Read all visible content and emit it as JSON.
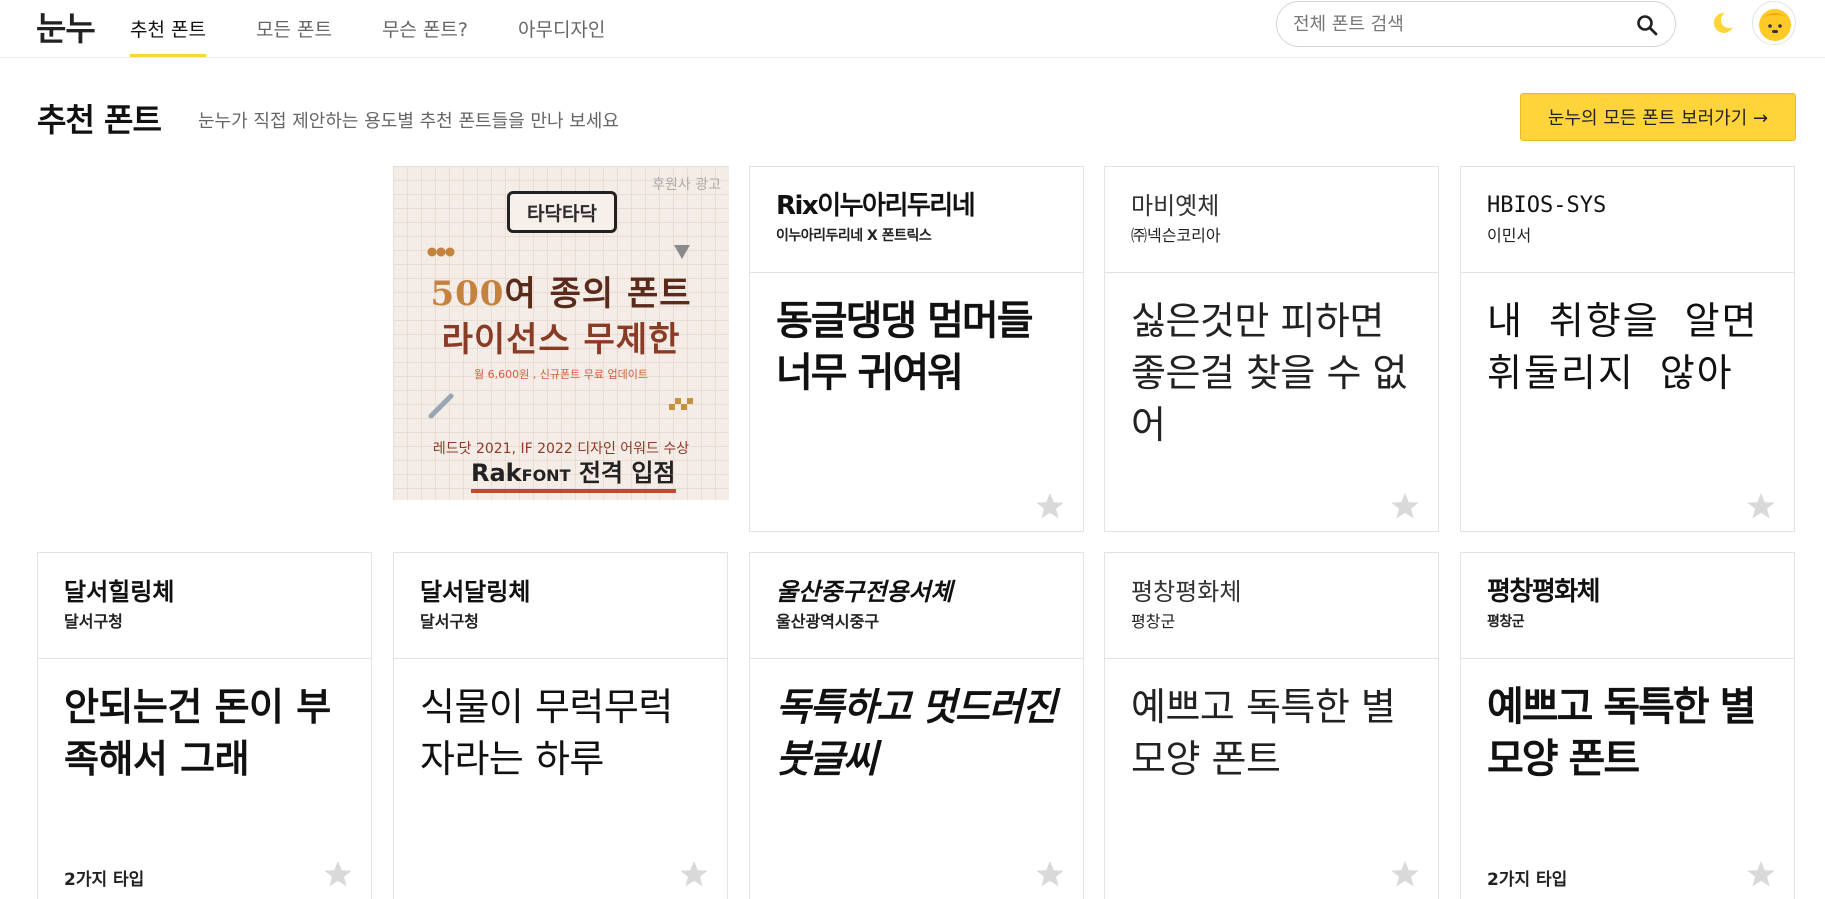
{
  "header": {
    "logo": "눈누",
    "nav": [
      {
        "label": "추천 폰트",
        "active": true
      },
      {
        "label": "모든 폰트",
        "active": false
      },
      {
        "label": "무슨 폰트?",
        "active": false
      },
      {
        "label": "아무디자인",
        "active": false
      }
    ],
    "search": {
      "placeholder": "전체 폰트 검색",
      "value": ""
    },
    "icons": {
      "search": "search-icon",
      "theme": "moon-icon",
      "profile": "avatar"
    }
  },
  "section": {
    "title": "추천 폰트",
    "subtitle": "눈누가 직접 제안하는 용도별 추천 폰트들을 만나 보세요",
    "all_fonts_button": "눈누의 모든 폰트 보러가기 →"
  },
  "ad": {
    "badge": "후원사 광고",
    "logo_text": "타닥타닥",
    "line1_highlight": "500",
    "line1_rest": "여 종의 폰트",
    "line2": "라이선스 무제한",
    "price": "월 6,600원 , 신규폰트 무료 업데이트",
    "award": "레드닷 2021, IF 2022 디자인 어워드 수상",
    "brand_bold": "Rak",
    "brand_small": "FONT",
    "brand_rest": " 전격 입점"
  },
  "cards": [
    {
      "name": "Rix이누아리두리네",
      "maker": "이누아리두리네 X 폰트릭스",
      "preview": "동글댕댕 멈머들 너무 귀여워",
      "types": ""
    },
    {
      "name": "마비옛체",
      "maker": "㈜넥슨코리아",
      "preview": "싫은것만 피하면 좋은걸 찾을 수 없어",
      "types": ""
    },
    {
      "name": "HBIOS-SYS",
      "maker": "이민서",
      "preview": "내 취향을 알면 휘둘리지 않아",
      "types": ""
    },
    {
      "name": "달서힐링체",
      "maker": "달서구청",
      "preview": "안되는건 돈이 부족해서 그래",
      "types": "2가지 타입"
    },
    {
      "name": "달서달링체",
      "maker": "달서구청",
      "preview": "식물이 무럭무럭 자라는 하루",
      "types": ""
    },
    {
      "name": "울산중구전용서체",
      "maker": "울산광역시중구",
      "preview": "독특하고 멋드러진 붓글씨",
      "types": ""
    },
    {
      "name": "평창평화체",
      "maker": "평창군",
      "preview": "예쁘고 독특한 별 모양 폰트",
      "types": ""
    },
    {
      "name": "평창평화체",
      "maker": "평창군",
      "preview": "예쁘고 독특한 별 모양 폰트",
      "types": "2가지 타입"
    }
  ],
  "colors": {
    "accent": "#ffd43b",
    "border": "#e3e3e3",
    "star": "#d9d9d9"
  }
}
